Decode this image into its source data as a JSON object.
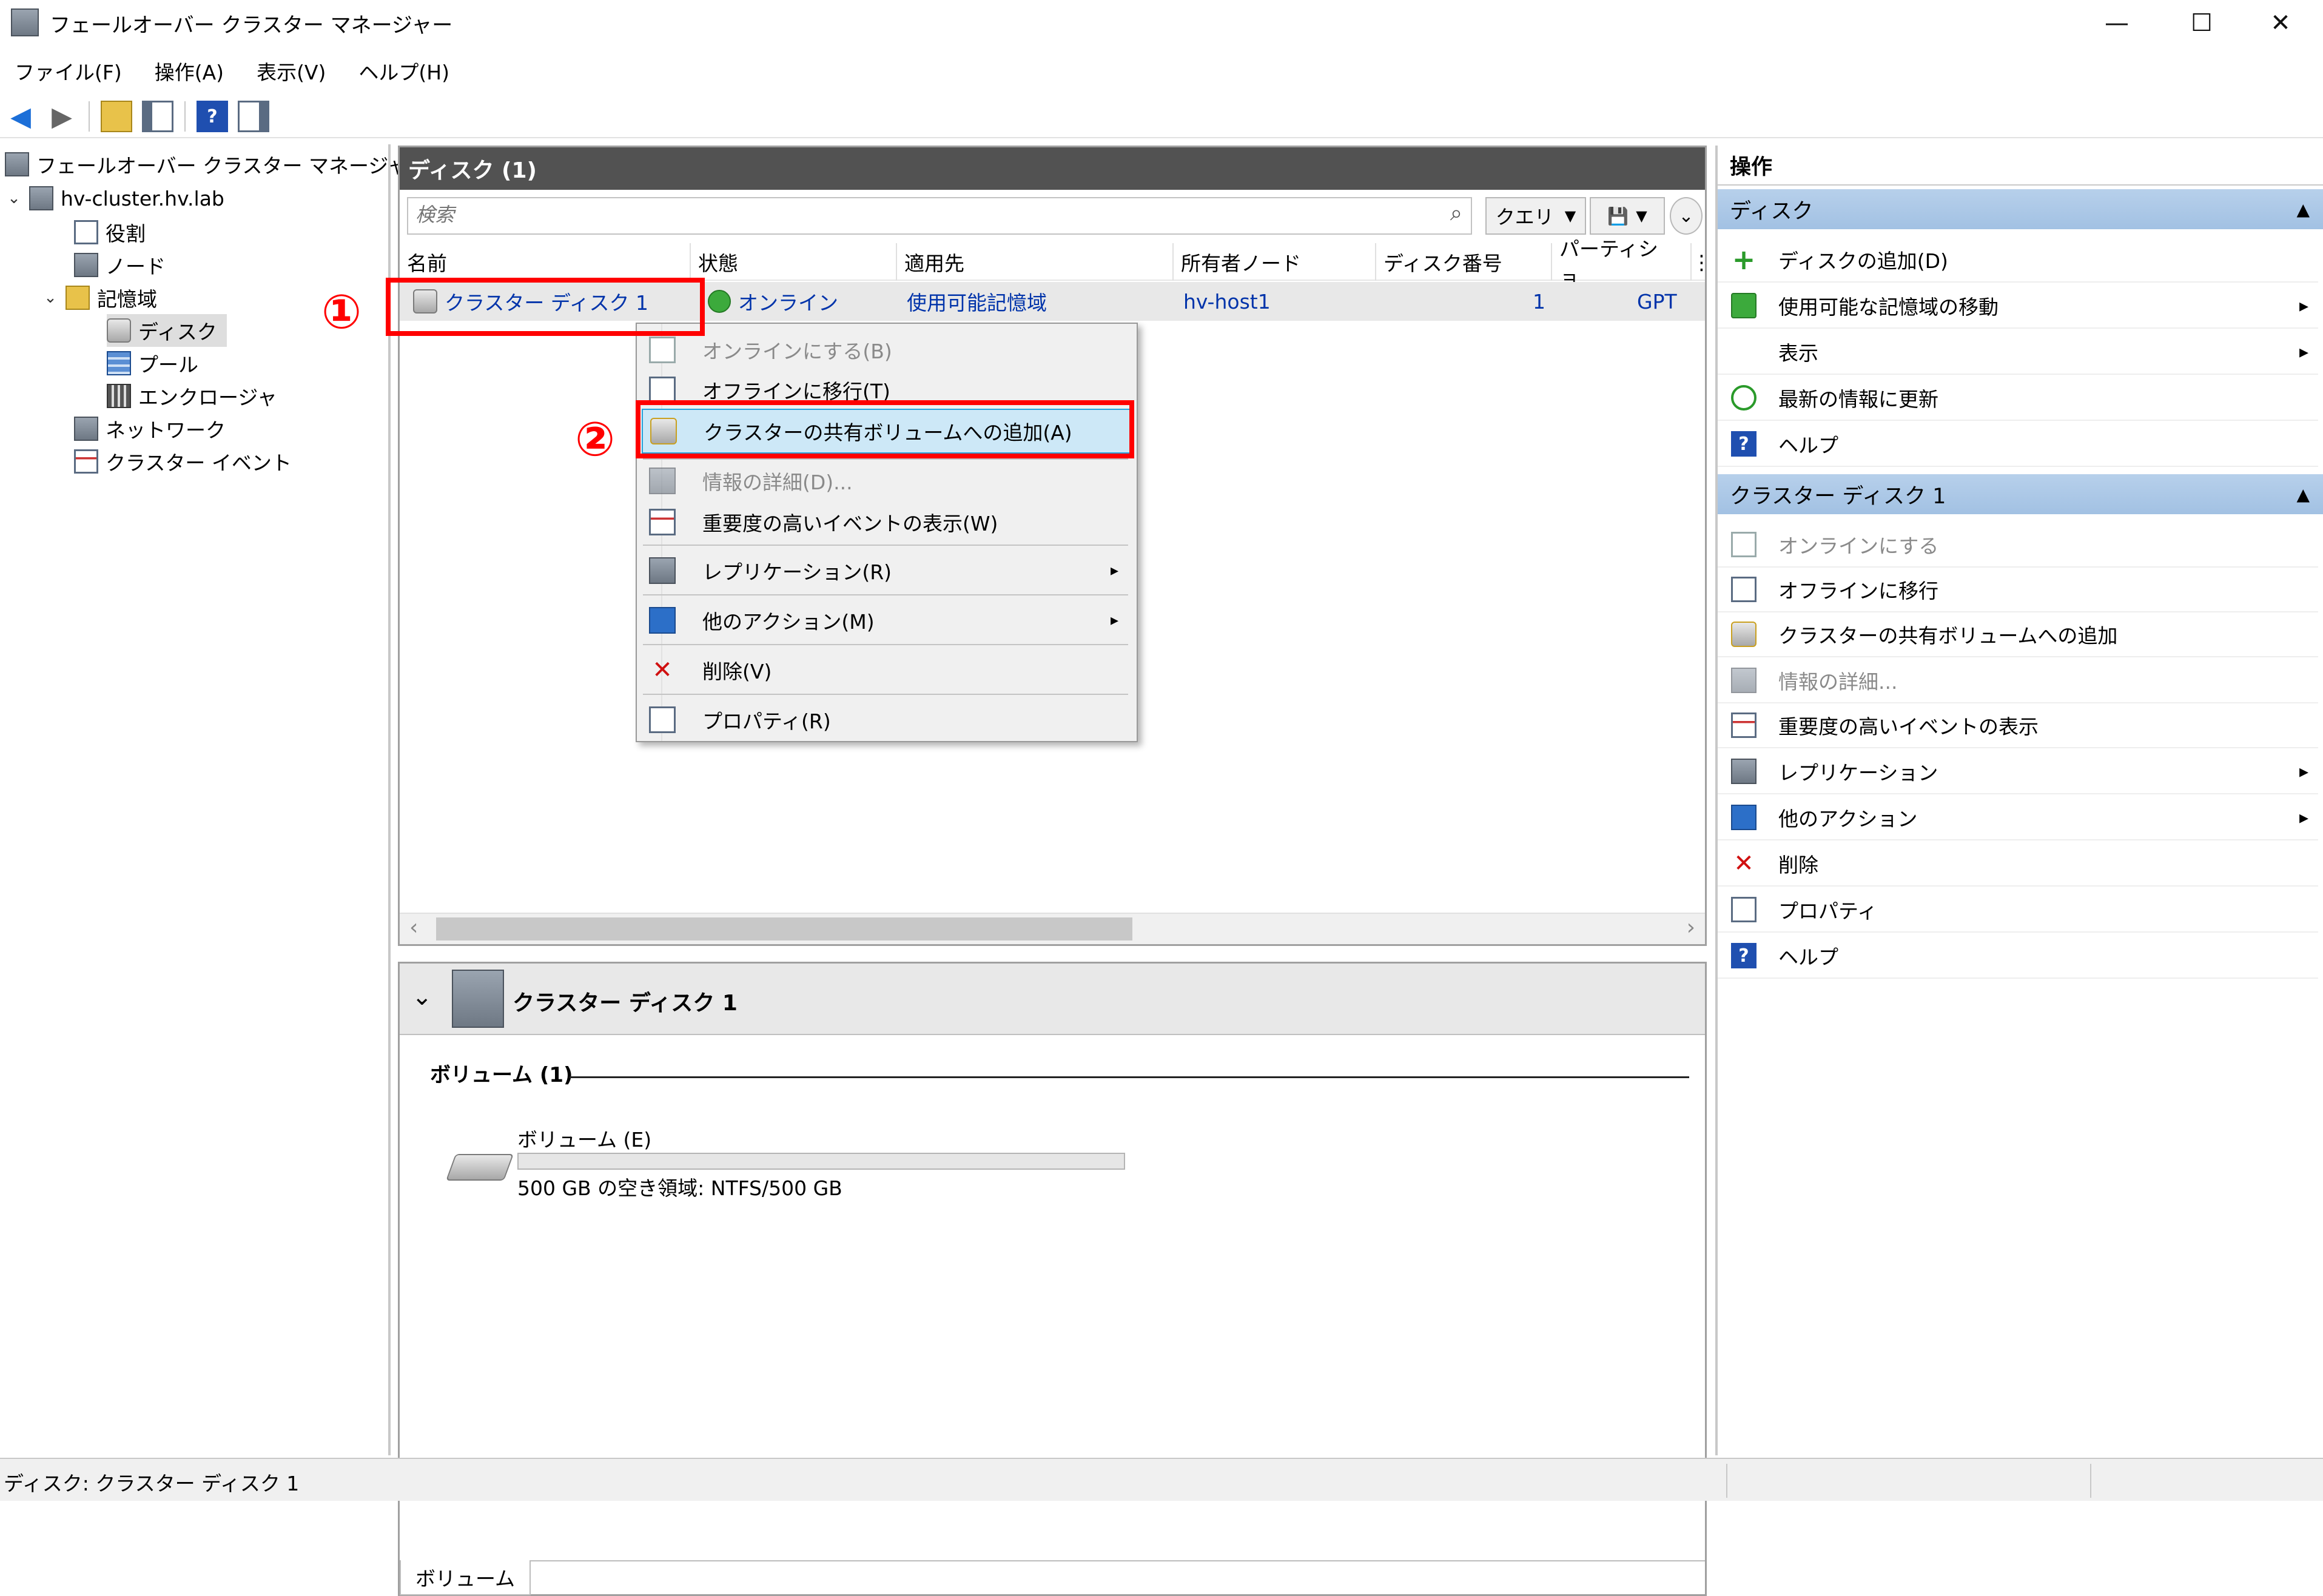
{
  "window": {
    "title": "フェールオーバー クラスター マネージャー",
    "controls": {
      "minimize": "—",
      "maximize": "☐",
      "close": "✕"
    }
  },
  "menubar": [
    "ファイル(F)",
    "操作(A)",
    "表示(V)",
    "ヘルプ(H)"
  ],
  "toolbar": {
    "back": "◀",
    "forward": "▶",
    "help": "?"
  },
  "tree": {
    "root": "フェールオーバー クラスター マネージャー",
    "cluster": "hv-cluster.hv.lab",
    "roles": "役割",
    "nodes": "ノード",
    "storage": "記憶域",
    "disks": "ディスク",
    "pools": "プール",
    "enclosures": "エンクロージャ",
    "networks": "ネットワーク",
    "events": "クラスター イベント",
    "expand_caret": "⌄",
    "collapse_caret": "›"
  },
  "disks_panel": {
    "header": "ディスク (1)",
    "search_placeholder": "検索",
    "search_icon": "⌕",
    "query_label": "クエリ",
    "dropdown": "▼",
    "save_icon": "💾",
    "expand": "⌄",
    "columns": [
      "名前",
      "状態",
      "適用先",
      "所有者ノード",
      "ディスク番号",
      "パーティショ…"
    ],
    "column_overflow": "⋮",
    "row": {
      "name": "クラスター ディスク 1",
      "status": "オンライン",
      "assigned_to": "使用可能記憶域",
      "owner_node": "hv-host1",
      "disk_number": "1",
      "partition_style": "GPT"
    },
    "scroll_left": "‹",
    "scroll_right": "›"
  },
  "context_menu": [
    {
      "label": "オンラインにする(B)",
      "enabled": false
    },
    {
      "label": "オフラインに移行(T)",
      "enabled": true
    },
    {
      "label": "クラスターの共有ボリュームへの追加(A)",
      "enabled": true,
      "highlighted": true
    },
    {
      "label": "情報の詳細(D)...",
      "enabled": false
    },
    {
      "label": "重要度の高いイベントの表示(W)",
      "enabled": true
    },
    {
      "label": "レプリケーション(R)",
      "enabled": true,
      "submenu": true
    },
    {
      "label": "他のアクション(M)",
      "enabled": true,
      "submenu": true
    },
    {
      "label": "削除(V)",
      "enabled": true
    },
    {
      "label": "プロパティ(R)",
      "enabled": true
    }
  ],
  "submenu_arrow": "▸",
  "annotations": {
    "one": "①",
    "two": "②"
  },
  "detail": {
    "collapse": "⌄",
    "title": "クラスター ディスク 1",
    "volume_section": "ボリューム (1)",
    "volume_name": "ボリューム (E)",
    "volume_info": "500 GB の空き領域: NTFS/500 GB",
    "volume_used_fraction": 0.0,
    "tab": "ボリューム"
  },
  "actions": {
    "title": "操作",
    "collapse": "▲",
    "arrow": "▸",
    "section_disks": "ディスク",
    "disks_items": [
      {
        "label": "ディスクの追加(D)",
        "submenu": false
      },
      {
        "label": "使用可能な記憶域の移動",
        "submenu": true
      },
      {
        "label": "表示",
        "submenu": true
      },
      {
        "label": "最新の情報に更新",
        "submenu": false
      },
      {
        "label": "ヘルプ",
        "submenu": false
      }
    ],
    "section_disk1": "クラスター ディスク 1",
    "disk1_items": [
      {
        "label": "オンラインにする",
        "enabled": false
      },
      {
        "label": "オフラインに移行",
        "enabled": true
      },
      {
        "label": "クラスターの共有ボリュームへの追加",
        "enabled": true
      },
      {
        "label": "情報の詳細...",
        "enabled": false
      },
      {
        "label": "重要度の高いイベントの表示",
        "enabled": true
      },
      {
        "label": "レプリケーション",
        "enabled": true,
        "submenu": true
      },
      {
        "label": "他のアクション",
        "enabled": true,
        "submenu": true
      },
      {
        "label": "削除",
        "enabled": true
      },
      {
        "label": "プロパティ",
        "enabled": true
      },
      {
        "label": "ヘルプ",
        "enabled": true
      }
    ]
  },
  "statusbar": "ディスク: クラスター ディスク 1",
  "colors": {
    "header_dark": "#525252",
    "section_blue": "#aac6e6",
    "highlight_red": "#ff0000",
    "menu_highlight": "#cde8f7"
  }
}
